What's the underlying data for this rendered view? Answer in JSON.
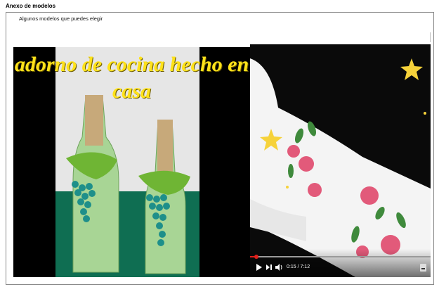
{
  "document": {
    "section_title": "Anexo de modelos",
    "caption": "Algunos modelos que puedes elegir"
  },
  "image_left": {
    "overlay_line1": "adorno de cocina hecho en",
    "overlay_line2": "casa"
  },
  "image_right": {
    "video_time": "0:15 / 7:12",
    "progress": 0.035
  },
  "colors": {
    "overlay_text": "#ffe21a",
    "progress_played": "#e0201b",
    "wall": "#e6e6e6",
    "table": "#0f6e52",
    "bottle_green": "#9fcf8a"
  }
}
